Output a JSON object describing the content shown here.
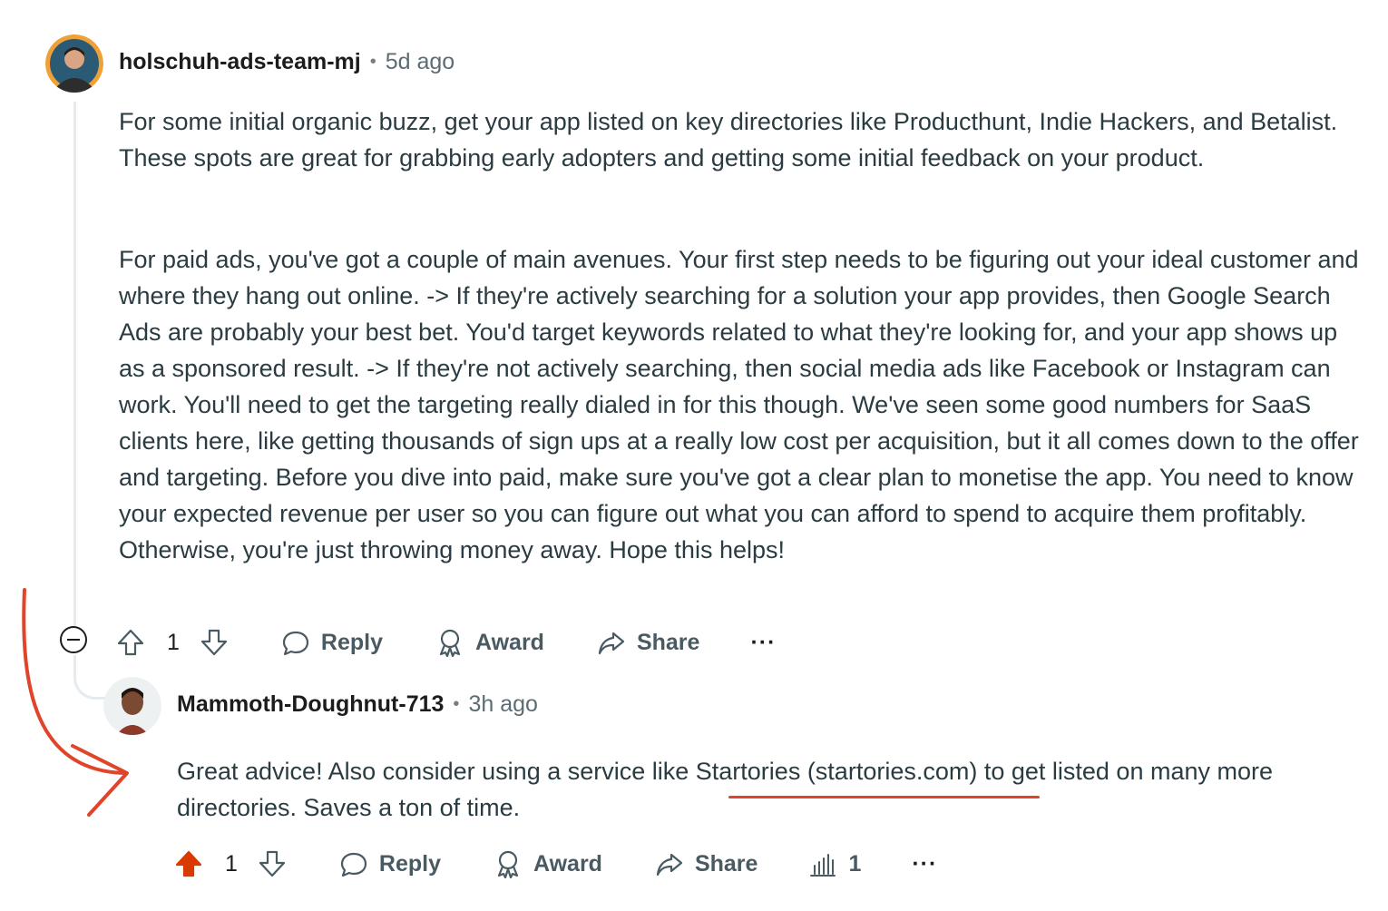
{
  "comment1": {
    "author": "holschuh-ads-team-mj",
    "separator": "•",
    "time": "5d ago",
    "paragraphs": [
      "For some initial organic buzz, get your app listed on key directories like Producthunt, Indie Hackers, and Betalist. These spots are great for grabbing early adopters and getting some initial feedback on your product.",
      "For paid ads, you've got a couple of main avenues. Your first step needs to be figuring out your ideal customer and where they hang out online. -> If they're actively searching for a solution your app provides, then Google Search Ads are probably your best bet. You'd target keywords related to what they're looking for, and your app shows up as a sponsored result. -> If they're not actively searching, then social media ads like Facebook or Instagram can work. You'll need to get the targeting really dialed in for this though. We've seen some good numbers for SaaS clients here, like getting thousands of sign ups at a really low cost per acquisition, but it all comes down to the offer and targeting. Before you dive into paid, make sure you've got a clear plan to monetise the app. You need to know your expected revenue per user so you can figure out what you can afford to spend to acquire them profitably. Otherwise, you're just throwing money away. Hope this helps!"
    ],
    "votes": "1",
    "actions": {
      "reply": "Reply",
      "award": "Award",
      "share": "Share",
      "more": "···"
    }
  },
  "comment2": {
    "author": "Mammoth-Doughnut-713",
    "separator": "•",
    "time": "3h ago",
    "paragraphs": [
      "Great advice! Also consider using a service like Startories (startories.com) to get listed on many more directories. Saves a ton of time."
    ],
    "votes": "1",
    "upvoted": true,
    "insights_count": "1",
    "actions": {
      "reply": "Reply",
      "award": "Award",
      "share": "Share",
      "more": "···"
    }
  },
  "colors": {
    "upvote_active": "#d93a00",
    "annotation": "#e0452b",
    "text": "#2a3c42",
    "meta": "#5c6c74",
    "thread_line": "#e5ebee"
  },
  "icons": [
    "upvote-icon",
    "downvote-icon",
    "reply-bubble-icon",
    "award-icon",
    "share-icon",
    "insights-icon",
    "more-icon",
    "collapse-icon"
  ]
}
